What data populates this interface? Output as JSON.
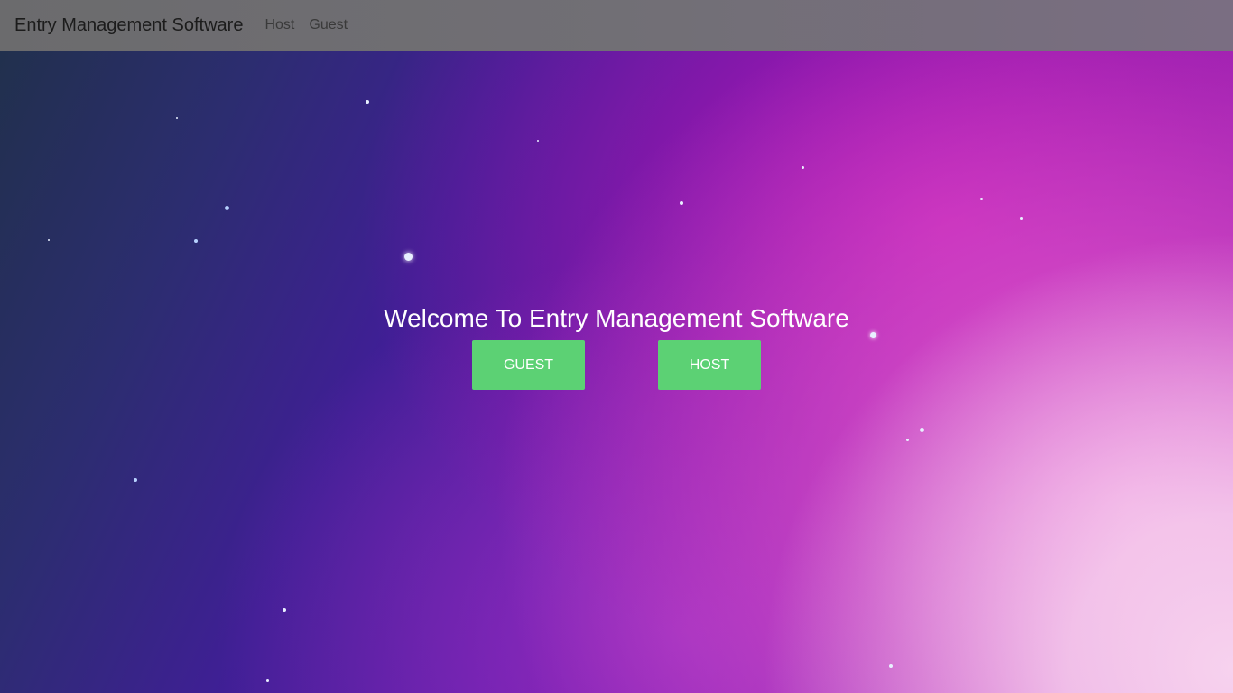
{
  "navbar": {
    "brand": "Entry Management Software",
    "links": [
      "Host",
      "Guest"
    ]
  },
  "hero": {
    "title": "Welcome To Entry Management Software",
    "buttons": {
      "guest": "GUEST",
      "host": "HOST"
    }
  },
  "colors": {
    "button_bg": "#5cd174",
    "navbar_bg": "#6f6d72",
    "text": "#ffffff"
  }
}
